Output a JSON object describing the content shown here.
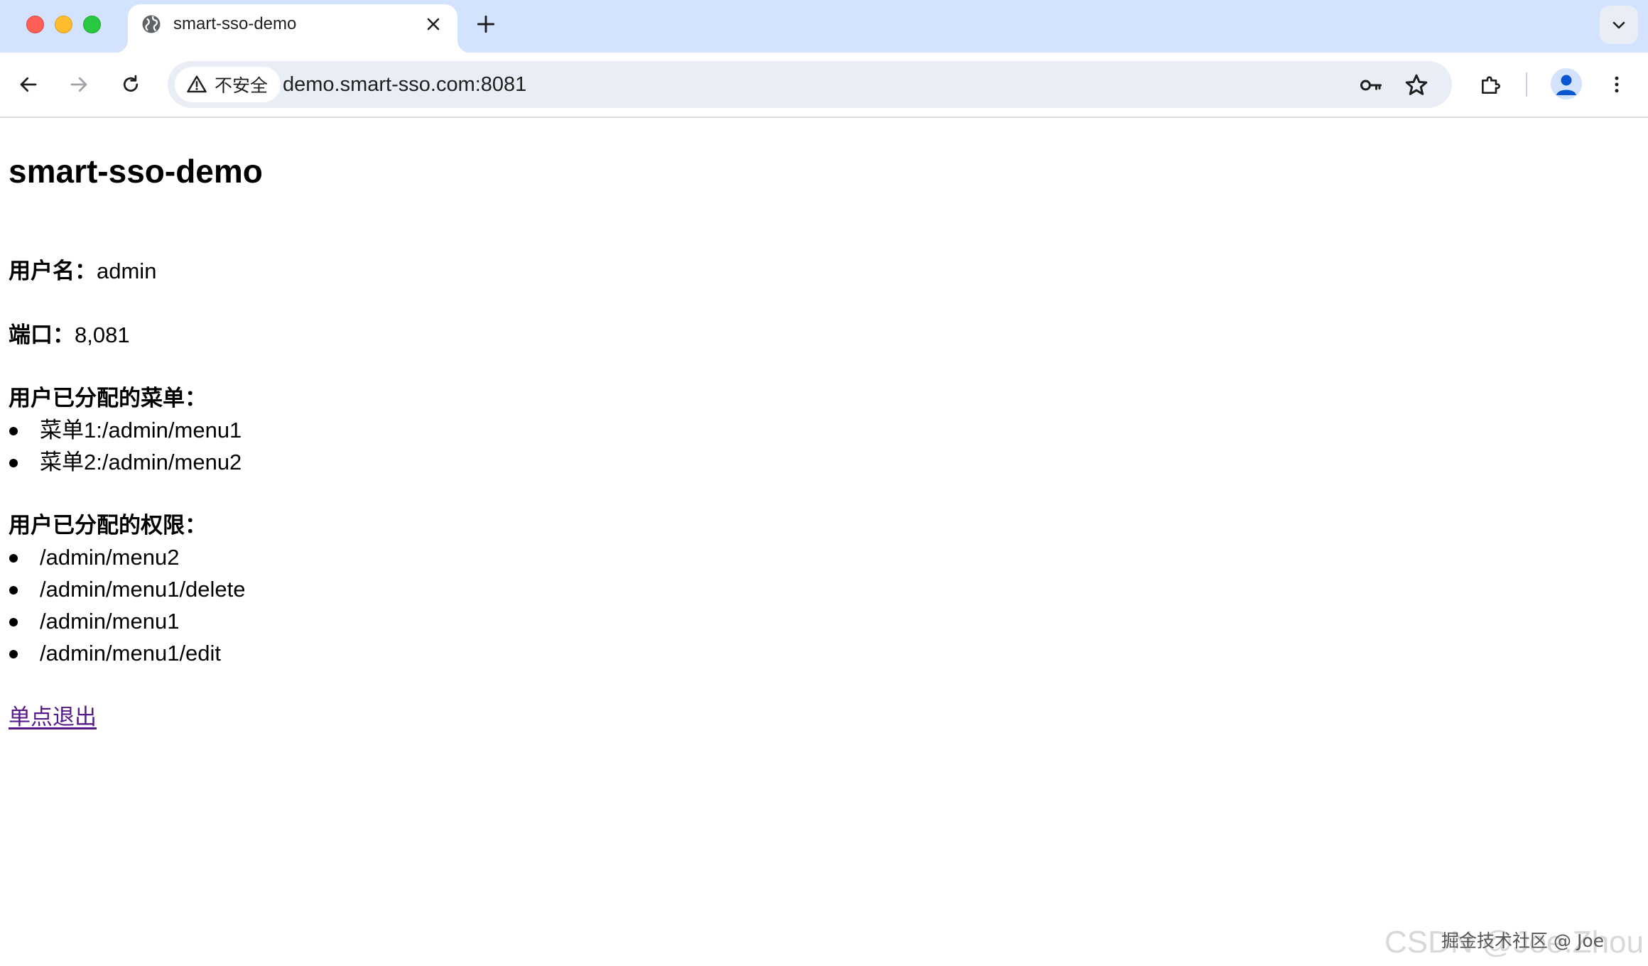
{
  "browser": {
    "tab": {
      "title": "smart-sso-demo",
      "favicon": "globe-icon"
    },
    "omnibox": {
      "security_label": "不安全",
      "url": "demo.smart-sso.com:8081"
    },
    "colors": {
      "tabstrip": "#d3e3fd",
      "omnibox": "#e9eef6",
      "accent": "#0b57d0"
    }
  },
  "page": {
    "title": "smart-sso-demo",
    "username": {
      "label": "用户名：",
      "value": "admin"
    },
    "port": {
      "label": "端口：",
      "value": "8,081"
    },
    "menus": {
      "heading": "用户已分配的菜单：",
      "items": [
        "菜单1:/admin/menu1",
        "菜单2:/admin/menu2"
      ]
    },
    "permissions": {
      "heading": "用户已分配的权限：",
      "items": [
        "/admin/menu2",
        "/admin/menu1/delete",
        "/admin/menu1",
        "/admin/menu1/edit"
      ]
    },
    "logout_link": "单点退出",
    "link_color": "#551a8b"
  },
  "watermark": {
    "front": "掘金技术社区 @ Joe",
    "back": "CSDN @Joe.Zhou"
  }
}
